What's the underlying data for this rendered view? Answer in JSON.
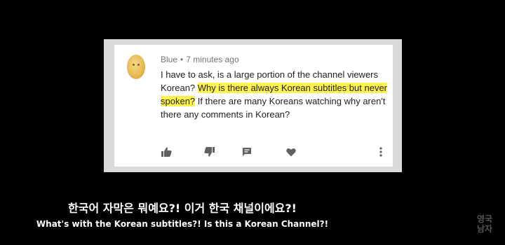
{
  "comment": {
    "author": "Blue",
    "separator": "•",
    "timestamp": "7 minutes ago",
    "text_before": "I have to ask, is a large portion of the channel viewers Korean? ",
    "text_highlight": "Why is there always Korean subtitles but never spoken?",
    "text_after": " If there are many Koreans watching why aren't there any comments in Korean?",
    "highlight_color": "#fff44f",
    "actions": [
      "thumbs-up-icon",
      "thumbs-down-icon",
      "reply-icon",
      "heart-icon",
      "more-vert-icon"
    ]
  },
  "subtitles": {
    "korean": "한국어 자막은 뭐예요?! 이거 한국 채널이에요?!",
    "english": "What's with the Korean subtitles?! Is this a Korean Channel?!"
  },
  "watermark": {
    "line1": "영국",
    "line2": "남자"
  }
}
